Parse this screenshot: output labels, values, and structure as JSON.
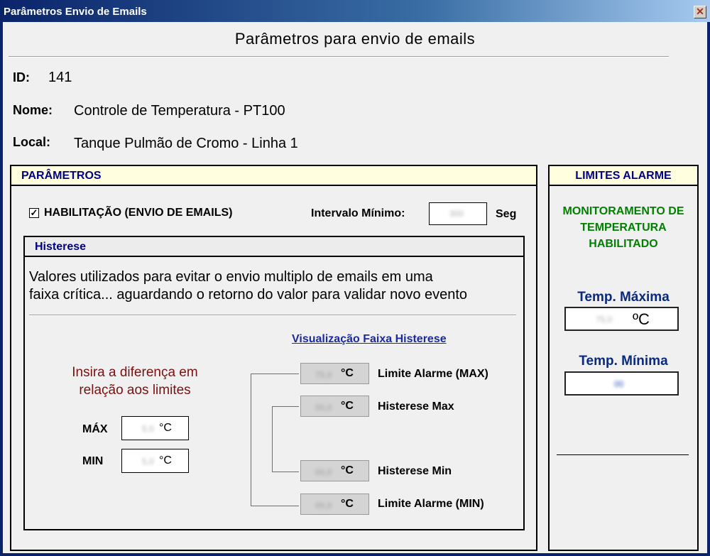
{
  "window": {
    "title": "Parâmetros Envio de Emails",
    "close_glyph": "✕"
  },
  "header": {
    "title": "Parâmetros para envio de emails"
  },
  "info": {
    "id_label": "ID:",
    "id_value": "141",
    "nome_label": "Nome:",
    "nome_value": "Controle de Temperatura - PT100",
    "local_label": "Local:",
    "local_value": "Tanque Pulmão de Cromo - Linha 1"
  },
  "parametros": {
    "title": "PARÂMETROS",
    "checkbox_mark": "✓",
    "checkbox_label": "HABILITAÇÃO (ENVIO DE EMAILS)",
    "checkbox_checked": true,
    "intervalo_label": "Intervalo Mínimo:",
    "intervalo_value": "300",
    "intervalo_unit": "Seg"
  },
  "histerese": {
    "title": "Histerese",
    "description_line1": "Valores utilizados para evitar o envio multiplo de emails em uma",
    "description_line2": "faixa crítica... aguardando o retorno do valor para validar novo evento",
    "hint_line1": "Insira a diferença em",
    "hint_line2": "relação aos limites",
    "max_label": "MÁX",
    "max_value": "5,0",
    "min_label": "MIN",
    "min_value": "5,0",
    "unit": "°C",
    "viz_link": "Visualização Faixa Histerese",
    "rows": [
      {
        "value": "75,0",
        "unit": "°C",
        "label": "Limite Alarme (MAX)"
      },
      {
        "value": "00,0",
        "unit": "°C",
        "label": "Histerese Max"
      },
      {
        "value": "00,0",
        "unit": "°C",
        "label": "Histerese Min"
      },
      {
        "value": "00,0",
        "unit": "°C",
        "label": "Limite Alarme (MIN)"
      }
    ]
  },
  "limites": {
    "title": "LIMITES ALARME",
    "status_line1": "MONITORAMENTO DE",
    "status_line2": "TEMPERATURA",
    "status_line3": "HABILITADO",
    "status_color": "#008000",
    "temp_max_label": "Temp. Máxima",
    "temp_max_value": "75,0",
    "temp_max_unit": "ºC",
    "temp_min_label": "Temp. Mínima",
    "temp_min_value": "00"
  }
}
